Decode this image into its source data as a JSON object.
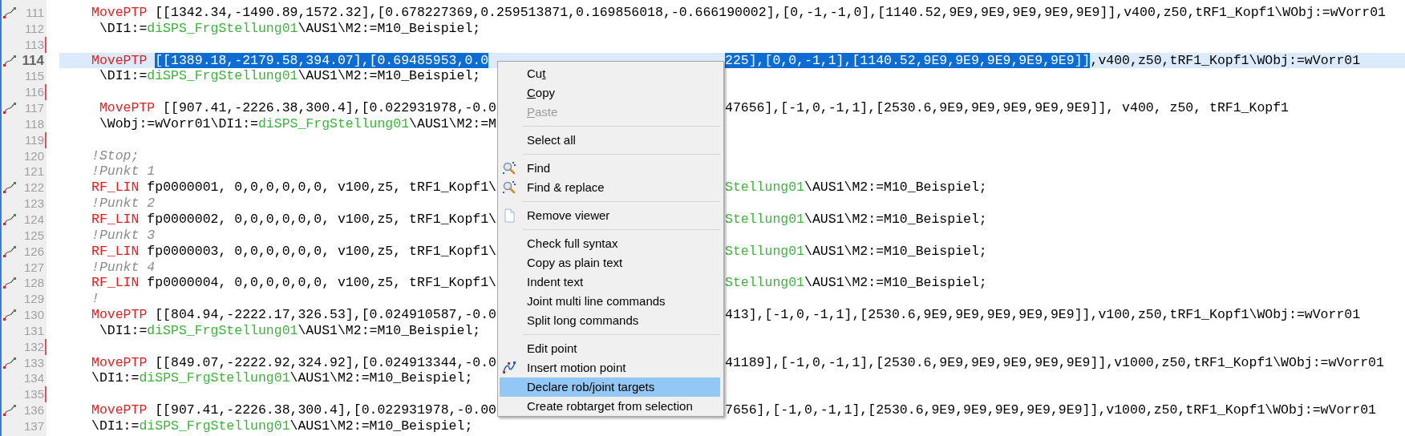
{
  "editor": {
    "lines": [
      {
        "number": "111",
        "kind": "motion",
        "current": false,
        "left": [
          {
            "kind": "keyword",
            "text": "MovePTP"
          },
          {
            "kind": "plain",
            "text": " [[1342.34,-1490.89,1572.32],[0.678227369,0.259513871,0.169856018,-0.666190002],[0,-1,-1,0],[1140.52,9E9,9E9,9E9,9E9,9E9]],v400,z50,tRF1_Kopf1\\WObj:=wVorr01"
          }
        ]
      },
      {
        "number": "112",
        "current": false,
        "left": [
          {
            "kind": "plain",
            "text": " \\DI1:="
          },
          {
            "kind": "signal",
            "text": "diSPS_FrgStellung01"
          },
          {
            "kind": "plain",
            "text": "\\AUS1\\M2:=M10_Beispiel;"
          }
        ]
      },
      {
        "number": "113",
        "kind": "changed",
        "current": false
      },
      {
        "number": "114",
        "kind": "motion",
        "current": true,
        "left": [
          {
            "kind": "keyword",
            "text": "MovePTP "
          },
          {
            "kind": "selection",
            "text": "[[1389.18,-2179.58,394.07],[0.69485953,0.0"
          }
        ],
        "right": [
          {
            "kind": "selection",
            "text": "225],[0,0,-1,1],[1140.52,9E9,9E9,9E9,9E9,9E9]]"
          },
          {
            "kind": "plain",
            "text": ",v400,z50,tRF1_Kopf1\\WObj:=wVorr01"
          }
        ]
      },
      {
        "number": "115",
        "current": false,
        "left": [
          {
            "kind": "plain",
            "text": " \\DI1:="
          },
          {
            "kind": "signal",
            "text": "diSPS_FrgStellung01"
          },
          {
            "kind": "plain",
            "text": "\\AUS1\\M2:=M10_Beispiel;"
          }
        ]
      },
      {
        "number": "116",
        "kind": "changed",
        "current": false
      },
      {
        "number": "117",
        "kind": "motion",
        "current": false,
        "left": [
          {
            "kind": "keyword",
            "text": " MovePTP"
          },
          {
            "kind": "plain",
            "text": " [[907.41,-2226.38,300.4],[0.022931978,-0.0"
          }
        ],
        "right": [
          {
            "kind": "plain",
            "text": "47656],[-1,0,-1,1],[2530.6,9E9,9E9,9E9,9E9,9E9]], v400, z50, tRF1_Kopf1"
          }
        ]
      },
      {
        "number": "118",
        "current": false,
        "left": [
          {
            "kind": "plain",
            "text": " \\Wobj:=wVorr01\\DI1:="
          },
          {
            "kind": "signal",
            "text": "diSPS_FrgStellung01"
          },
          {
            "kind": "plain",
            "text": "\\AUS1\\M2:=M"
          }
        ]
      },
      {
        "number": "119",
        "kind": "changed",
        "current": false
      },
      {
        "number": "120",
        "current": false,
        "left": [
          {
            "kind": "comment",
            "text": "!Stop;"
          }
        ]
      },
      {
        "number": "121",
        "current": false,
        "left": [
          {
            "kind": "comment",
            "text": "!Punkt 1"
          }
        ]
      },
      {
        "number": "122",
        "kind": "motion",
        "current": false,
        "left": [
          {
            "kind": "keyword",
            "text": "RF_LIN"
          },
          {
            "kind": "plain",
            "text": " fp0000001, 0,0,0,0,0,0, v100,z5, tRF1_Kopf1\\"
          }
        ],
        "right": [
          {
            "kind": "signal",
            "text": "Stellung01"
          },
          {
            "kind": "plain",
            "text": "\\AUS1\\M2:=M10_Beispiel;"
          }
        ]
      },
      {
        "number": "123",
        "current": false,
        "left": [
          {
            "kind": "comment",
            "text": "!Punkt 2"
          }
        ]
      },
      {
        "number": "124",
        "kind": "motion",
        "current": false,
        "left": [
          {
            "kind": "keyword",
            "text": "RF_LIN"
          },
          {
            "kind": "plain",
            "text": " fp0000002, 0,0,0,0,0,0, v100,z5, tRF1_Kopf1\\"
          }
        ],
        "right": [
          {
            "kind": "signal",
            "text": "Stellung01"
          },
          {
            "kind": "plain",
            "text": "\\AUS1\\M2:=M10_Beispiel;"
          }
        ]
      },
      {
        "number": "125",
        "current": false,
        "left": [
          {
            "kind": "comment",
            "text": "!Punkt 3"
          }
        ]
      },
      {
        "number": "126",
        "kind": "motion",
        "current": false,
        "left": [
          {
            "kind": "keyword",
            "text": "RF_LIN"
          },
          {
            "kind": "plain",
            "text": " fp0000003, 0,0,0,0,0,0, v100,z5, tRF1_Kopf1\\"
          }
        ],
        "right": [
          {
            "kind": "signal",
            "text": "Stellung01"
          },
          {
            "kind": "plain",
            "text": "\\AUS1\\M2:=M10_Beispiel;"
          }
        ]
      },
      {
        "number": "127",
        "current": false,
        "left": [
          {
            "kind": "comment",
            "text": "!Punkt 4"
          }
        ]
      },
      {
        "number": "128",
        "kind": "motion",
        "current": false,
        "left": [
          {
            "kind": "keyword",
            "text": "RF_LIN"
          },
          {
            "kind": "plain",
            "text": " fp0000004, 0,0,0,0,0,0, v100,z5, tRF1_Kopf1\\"
          }
        ],
        "right": [
          {
            "kind": "signal",
            "text": "Stellung01"
          },
          {
            "kind": "plain",
            "text": "\\AUS1\\M2:=M10_Beispiel;"
          }
        ]
      },
      {
        "number": "129",
        "current": false,
        "left": [
          {
            "kind": "comment",
            "text": "!"
          }
        ]
      },
      {
        "number": "130",
        "kind": "motion",
        "current": false,
        "left": [
          {
            "kind": "keyword",
            "text": "MovePTP"
          },
          {
            "kind": "plain",
            "text": " [[804.94,-2222.17,326.53],[0.024910587,-0.0"
          }
        ],
        "right": [
          {
            "kind": "plain",
            "text": "413],[-1,0,-1,1],[2530.6,9E9,9E9,9E9,9E9,9E9]],v100,z50,tRF1_Kopf1\\WObj:=wVorr01"
          }
        ]
      },
      {
        "number": "131",
        "current": false,
        "left": [
          {
            "kind": "plain",
            "text": " \\DI1:="
          },
          {
            "kind": "signal",
            "text": "diSPS_FrgStellung01"
          },
          {
            "kind": "plain",
            "text": "\\AUS1\\M2:=M10_Beispiel;"
          }
        ]
      },
      {
        "number": "132",
        "kind": "changed",
        "current": false
      },
      {
        "number": "133",
        "kind": "motion",
        "current": false,
        "left": [
          {
            "kind": "keyword",
            "text": "MovePTP"
          },
          {
            "kind": "plain",
            "text": " [[849.07,-2222.92,324.92],[0.024913344,-0.0"
          }
        ],
        "right": [
          {
            "kind": "plain",
            "text": "41189],[-1,0,-1,1],[2530.6,9E9,9E9,9E9,9E9,9E9]],v1000,z50,tRF1_Kopf1\\WObj:=wVorr01"
          }
        ]
      },
      {
        "number": "134",
        "current": false,
        "left": [
          {
            "kind": "plain",
            "text": "\\DI1:="
          },
          {
            "kind": "signal",
            "text": "diSPS_FrgStellung01"
          },
          {
            "kind": "plain",
            "text": "\\AUS1\\M2:=M10_Beispiel;"
          }
        ]
      },
      {
        "number": "135",
        "kind": "changed",
        "current": false
      },
      {
        "number": "136",
        "kind": "motion",
        "current": false,
        "left": [
          {
            "kind": "keyword",
            "text": "MovePTP"
          },
          {
            "kind": "plain",
            "text": " [[907.41,-2226.38,300.4],[0.022931978,-0.00"
          }
        ],
        "right": [
          {
            "kind": "plain",
            "text": "7656],[-1,0,-1,1],[2530.6,9E9,9E9,9E9,9E9,9E9]],v1000,z50,tRF1_Kopf1\\WObj:=wVorr01"
          }
        ]
      },
      {
        "number": "137",
        "current": false,
        "left": [
          {
            "kind": "plain",
            "text": "\\DI1:="
          },
          {
            "kind": "signal",
            "text": "diSPS_FrgStellung01"
          },
          {
            "kind": "plain",
            "text": "\\AUS1\\M2:=M10_Beispiel;"
          }
        ]
      }
    ]
  },
  "context_menu": {
    "groups": [
      [
        {
          "before": "Cu",
          "key": "t",
          "disabled": false,
          "selected": false
        },
        {
          "key": "C",
          "after": "opy",
          "disabled": false,
          "selected": false
        },
        {
          "key": "P",
          "after": "aste",
          "disabled": true,
          "selected": false
        }
      ],
      [
        {
          "label": "Select all",
          "disabled": false,
          "selected": false
        }
      ],
      [
        {
          "label": "Find",
          "kind": "search",
          "disabled": false,
          "selected": false
        },
        {
          "label": "Find & replace",
          "kind": "search",
          "disabled": false,
          "selected": false
        }
      ],
      [
        {
          "label": "Remove viewer",
          "kind": "document",
          "disabled": false,
          "selected": false
        }
      ],
      [
        {
          "label": "Check full syntax",
          "disabled": false,
          "selected": false
        },
        {
          "label": "Copy as plain text",
          "disabled": false,
          "selected": false
        },
        {
          "label": "Indent text",
          "disabled": false,
          "selected": false
        },
        {
          "label": "Joint multi line commands",
          "disabled": false,
          "selected": false
        },
        {
          "label": "Split long commands",
          "disabled": false,
          "selected": false
        }
      ],
      [
        {
          "label": "Edit point",
          "disabled": false,
          "selected": false
        },
        {
          "label": "Insert motion point",
          "kind": "motion",
          "disabled": false,
          "selected": false
        },
        {
          "label": "Declare rob/joint targets",
          "disabled": false,
          "selected": true
        },
        {
          "label": "Create robtarget from selection",
          "disabled": false,
          "selected": false
        }
      ]
    ]
  }
}
